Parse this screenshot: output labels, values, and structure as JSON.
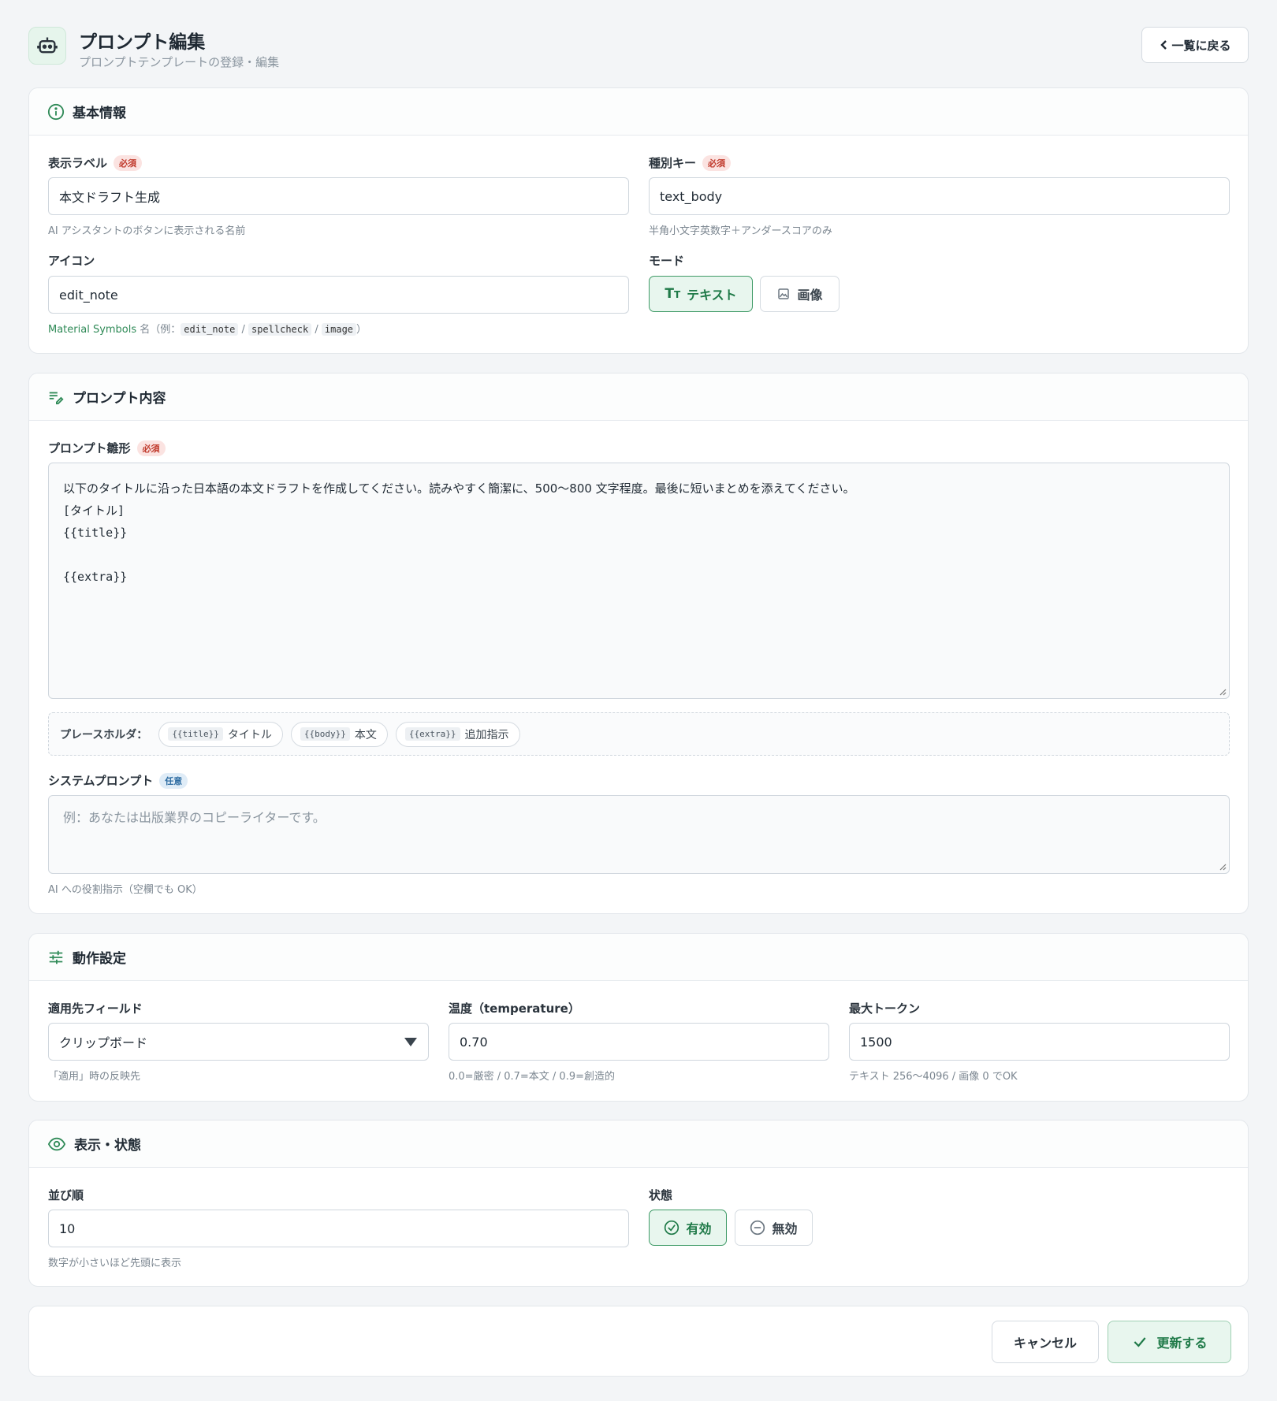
{
  "header": {
    "title": "プロンプト編集",
    "subtitle": "プロンプトテンプレートの登録・編集",
    "back_label": "一覧に戻る"
  },
  "badges": {
    "required": "必須",
    "optional": "任意"
  },
  "basic": {
    "section_title": "基本情報",
    "label_field": {
      "label": "表示ラベル",
      "value": "本文ドラフト生成",
      "hint": "AI アシスタントのボタンに表示される名前"
    },
    "key_field": {
      "label": "種別キー",
      "value": "text_body",
      "hint": "半角小文字英数字＋アンダースコアのみ"
    },
    "icon_field": {
      "label": "アイコン",
      "value": "edit_note",
      "hint_prefix": "Material Symbols",
      "hint_mid": " 名（例：",
      "ex1": "edit_note",
      "ex2": "spellcheck",
      "ex3": "image",
      "sep": " / ",
      "hint_end": "）"
    },
    "mode": {
      "label": "モード",
      "text_label": "テキスト",
      "image_label": "画像",
      "selected": "text"
    }
  },
  "prompt": {
    "section_title": "プロンプト内容",
    "template_label": "プロンプト雛形",
    "template_lines": [
      "以下のタイトルに沿った日本語の本文ドラフトを作成してください。読みやすく簡潔に、500〜800 文字程度。最後に短いまとめを添えてください。",
      "[タイトル]",
      "{{title}}",
      "",
      "{{extra}}"
    ],
    "placeholder_label": "プレースホルダ：",
    "placeholders": [
      {
        "code": "{{title}}",
        "label": "タイトル"
      },
      {
        "code": "{{body}}",
        "label": "本文"
      },
      {
        "code": "{{extra}}",
        "label": "追加指示"
      }
    ],
    "system_label": "システムプロンプト",
    "system_placeholder": "例：あなたは出版業界のコピーライターです。",
    "system_hint": "AI への役割指示（空欄でも OK）"
  },
  "behavior": {
    "section_title": "動作設定",
    "target": {
      "label": "適用先フィールド",
      "value": "クリップボード",
      "hint": "「適用」時の反映先"
    },
    "temperature": {
      "label": "温度（temperature）",
      "value": "0.70",
      "hint": "0.0=厳密 / 0.7=本文 / 0.9=創造的"
    },
    "max_tokens": {
      "label": "最大トークン",
      "value": "1500",
      "hint": "テキスト 256〜4096 / 画像 0 でOK"
    }
  },
  "display": {
    "section_title": "表示・状態",
    "order": {
      "label": "並び順",
      "value": "10",
      "hint": "数字が小さいほど先頭に表示"
    },
    "status": {
      "label": "状態",
      "enabled_label": "有効",
      "disabled_label": "無効",
      "selected": "enabled"
    }
  },
  "footer": {
    "cancel_label": "キャンセル",
    "submit_label": "更新する"
  },
  "colors": {
    "accent": "#1f7a48",
    "accent_bg": "#e8f6ee",
    "required": "#c0392b",
    "optional": "#2d6ca2"
  }
}
